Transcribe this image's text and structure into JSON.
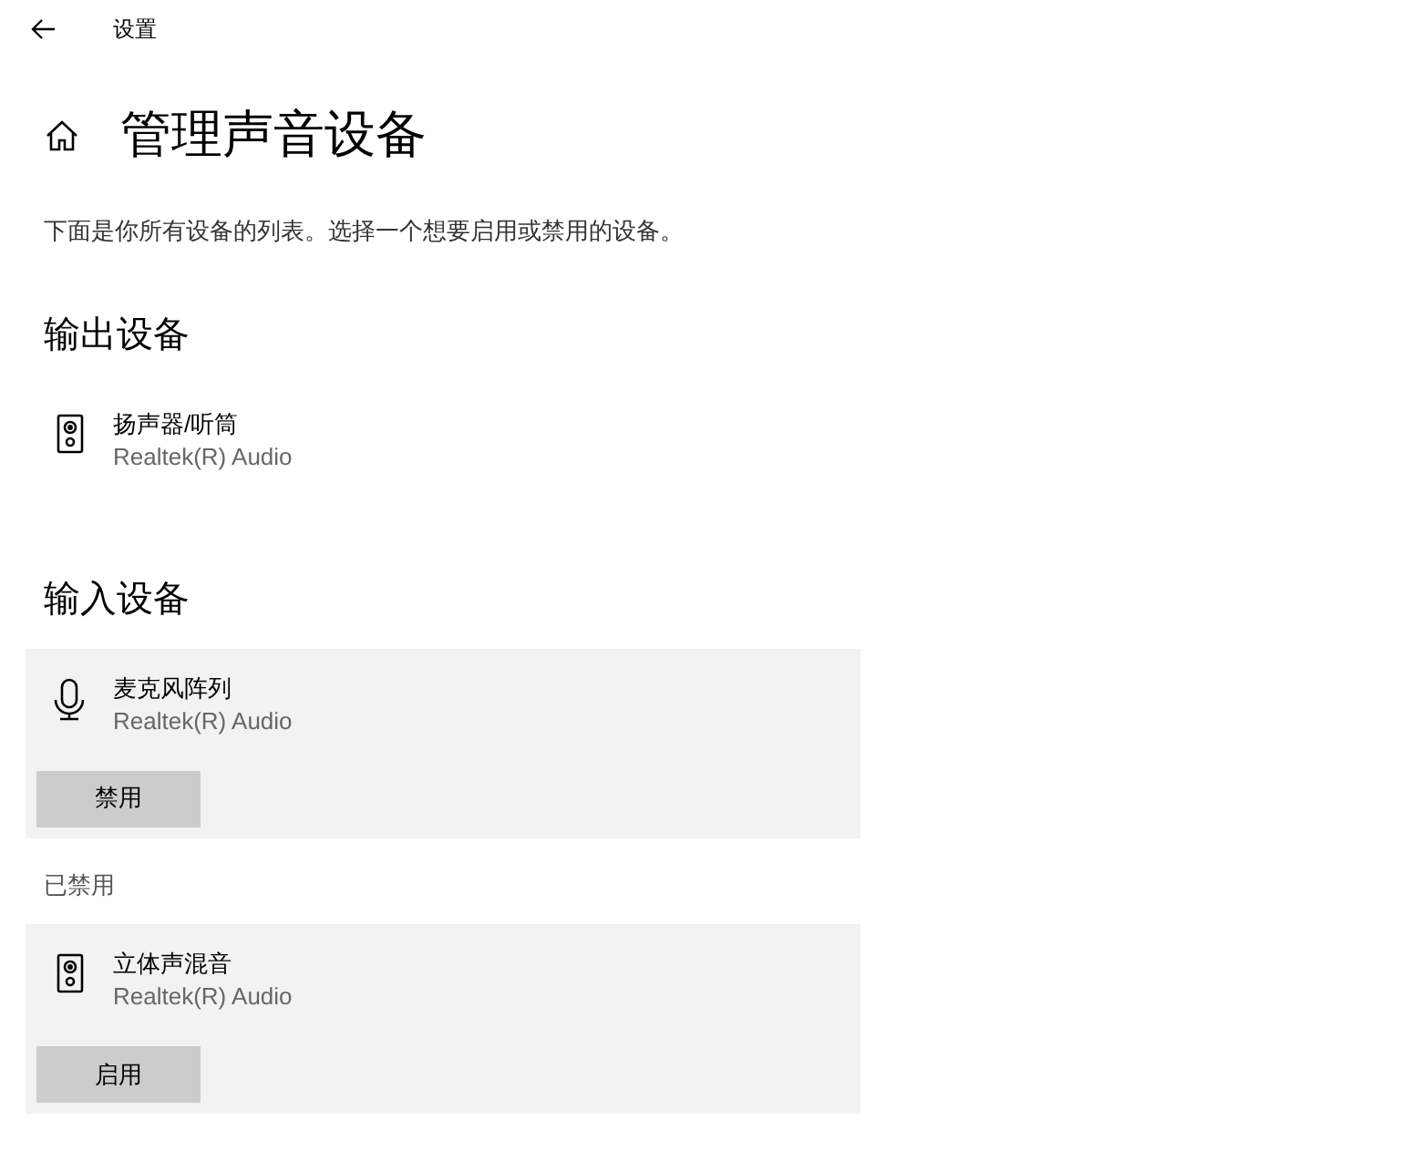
{
  "window": {
    "title": "设置"
  },
  "page": {
    "title": "管理声音设备",
    "description": "下面是你所有设备的列表。选择一个想要启用或禁用的设备。"
  },
  "sections": [
    {
      "heading": "输出设备",
      "devices": [
        {
          "kind": "speaker",
          "name": "扬声器/听筒",
          "driver": "Realtek(R) Audio",
          "expanded": false
        }
      ]
    },
    {
      "heading": "输入设备",
      "devices": [
        {
          "kind": "microphone",
          "name": "麦克风阵列",
          "driver": "Realtek(R) Audio",
          "expanded": true,
          "button": "禁用"
        }
      ],
      "disabled_heading": "已禁用",
      "disabled_devices": [
        {
          "kind": "speaker",
          "name": "立体声混音",
          "driver": "Realtek(R) Audio",
          "expanded": true,
          "button": "启用"
        }
      ]
    }
  ]
}
